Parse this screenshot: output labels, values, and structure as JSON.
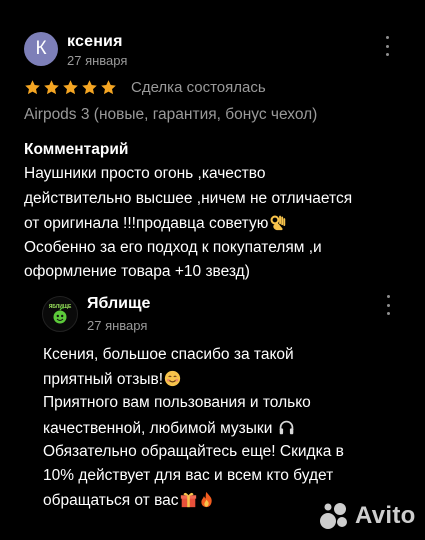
{
  "review": {
    "avatar_letter": "К",
    "avatar_color": "#7d7fb8",
    "author": "ксения",
    "date": "27 января",
    "rating": 5,
    "status": "Сделка состоялась",
    "product": "Airpods 3 (новые, гарантия, бонус чехол)",
    "comment_title": "Комментарий",
    "comment_lines": [
      "Наушники просто огонь ,качество",
      "действительно высшее ,ничем не отличается",
      "от оригинала !!!продавца советую",
      "Особенно за его подход к покупателям ,и",
      "оформление товара +10 звезд)"
    ],
    "comment_icons": [
      "ok-hand-emoji-icon"
    ]
  },
  "reply": {
    "author": "Яблище",
    "date": "27 января",
    "avatar_logo_text": "ЯБЛИЩЕ",
    "lines": [
      "Ксения, большое спасибо за такой",
      "приятный отзыв!",
      "Приятного вам пользования и только",
      "качественной, любимой музыки",
      "Обязательно обращайтесь еще! Скидка в",
      "10% действует для вас и всем кто будет",
      "обращаться от вас"
    ],
    "icons": [
      "smiling-face-emoji-icon",
      "headphones-emoji-icon",
      "gift-emoji-icon",
      "fire-emoji-icon"
    ]
  },
  "watermark": {
    "text": "Avito"
  },
  "colors": {
    "star": "#f5a623",
    "muted": "#9a9a9a",
    "background": "#000000"
  }
}
